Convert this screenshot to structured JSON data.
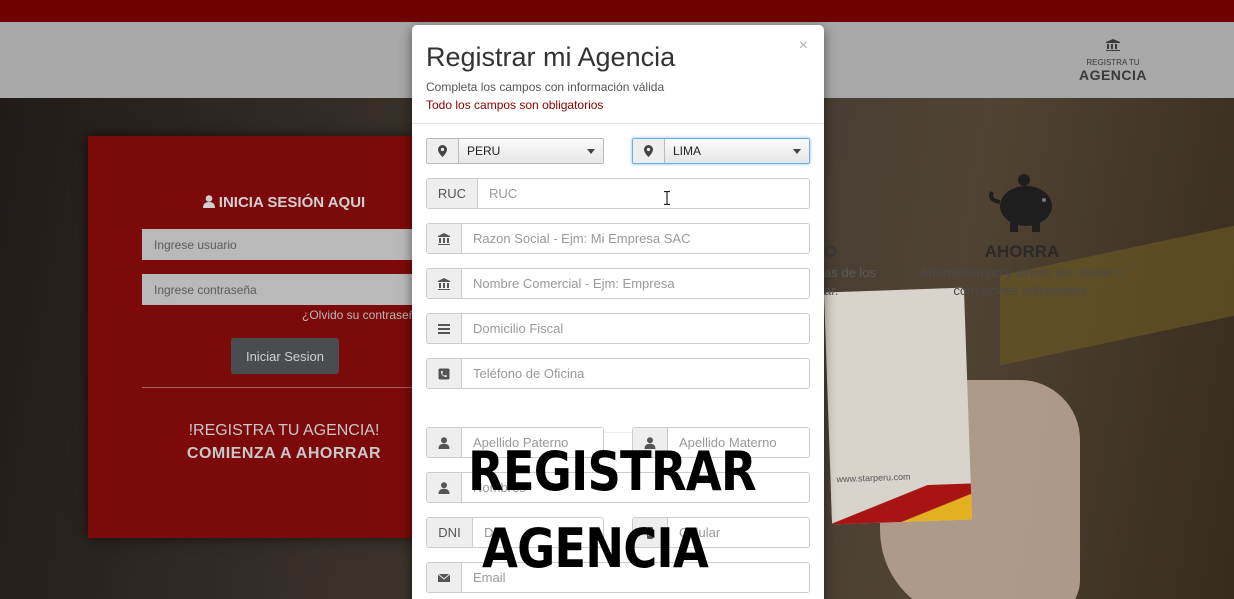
{
  "navbar": {
    "register_small": "REGISTRA TU",
    "register_big": "AGENCIA"
  },
  "feature": {
    "title": "AHORRA",
    "desc_line1": "Ahorre tiempo y dinero sin costos o",
    "desc_line2": "comisiones adicionales.",
    "partial_title": "O",
    "partial_desc_line1": "as de los",
    "partial_desc_line2": "ar."
  },
  "card": {
    "url": "www.starperu.com"
  },
  "login": {
    "title": "INICIA SESIÓN AQUI",
    "username_placeholder": "Ingrese usuario",
    "password_placeholder": "Ingrese contraseña",
    "forgot": "¿Olvido su contraseña?",
    "submit": "Iniciar Sesion",
    "register_line1": "!REGISTRA TU AGENCIA!",
    "register_line2": "COMIENZA A AHORRAR"
  },
  "modal": {
    "title": "Registrar mi Agencia",
    "subtitle": "Completa los campos con información válida",
    "required_note": "Todo los campos son obligatorios",
    "close": "×",
    "country": "PERU",
    "city": "LIMA",
    "fields": {
      "ruc_label": "RUC",
      "ruc_placeholder": "RUC",
      "razon_social": "Razon Social - Ejm: Mi Empresa SAC",
      "nombre_comercial": "Nombre Comercial - Ejm: Empresa",
      "domicilio": "Domicilio Fiscal",
      "telefono": "Teléfono de Oficina",
      "apellido_paterno": "Apellido Paterno",
      "apellido_materno": "Apellido Materno",
      "nombres": "Nombres",
      "dni_label": "DNI",
      "dni_placeholder": "DNI",
      "celular": "Celular",
      "email": "Email"
    }
  },
  "overlay": {
    "line1": "REGISTRAR",
    "line2": "AGENCIA"
  }
}
